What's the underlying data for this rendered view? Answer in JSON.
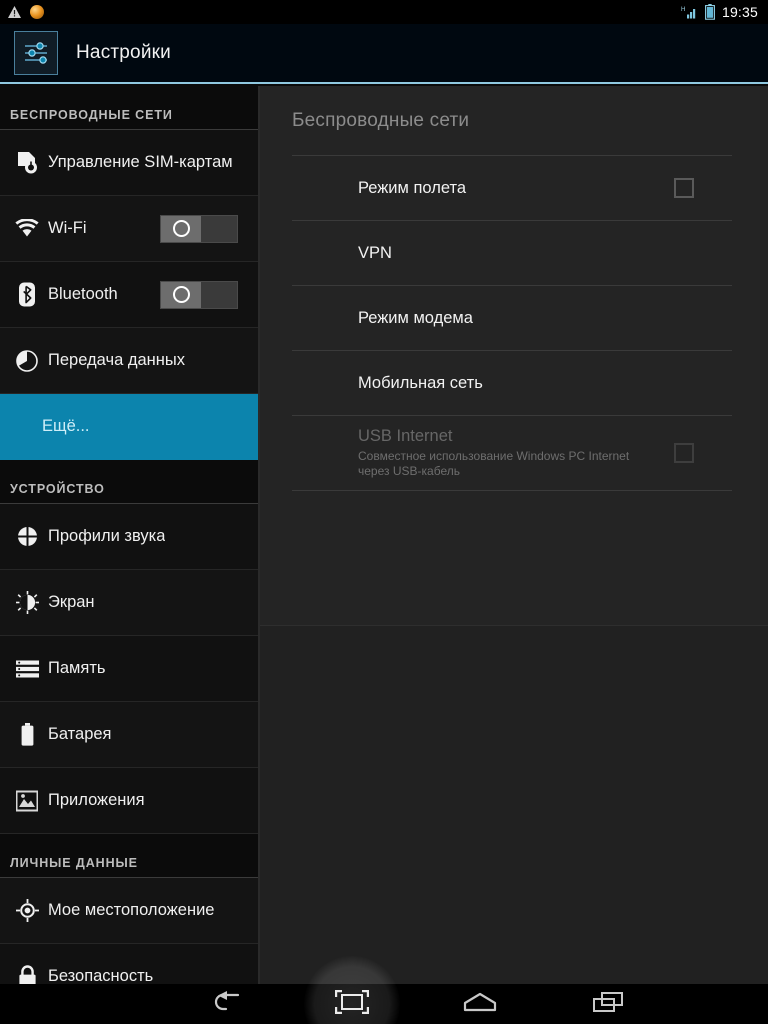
{
  "statusbar": {
    "time": "19:35",
    "notification_icons": [
      "warning-triangle-icon",
      "amber-circle-icon"
    ],
    "system_icons": [
      "signal-h-icon",
      "battery-icon"
    ],
    "signal_label": "H"
  },
  "actionbar": {
    "app_icon": "settings-sliders-icon",
    "title": "Настройки"
  },
  "sidebar": {
    "sections": [
      {
        "header": "БЕСПРОВОДНЫЕ СЕТИ",
        "items": [
          {
            "label": "Управление SIM-картам",
            "icon": "sim-card-icon",
            "control": "none",
            "selected": false
          },
          {
            "label": "Wi-Fi",
            "icon": "wifi-icon",
            "control": "toggle",
            "toggle_state": "off",
            "selected": false
          },
          {
            "label": "Bluetooth",
            "icon": "bluetooth-icon",
            "control": "toggle",
            "toggle_state": "off",
            "selected": false
          },
          {
            "label": "Передача данных",
            "icon": "data-usage-icon",
            "control": "none",
            "selected": false
          },
          {
            "label": "Ещё...",
            "icon": "none",
            "control": "none",
            "selected": true
          }
        ]
      },
      {
        "header": "УСТРОЙСТВО",
        "items": [
          {
            "label": "Профили звука",
            "icon": "sound-profile-icon",
            "control": "none",
            "selected": false
          },
          {
            "label": "Экран",
            "icon": "display-brightness-icon",
            "control": "none",
            "selected": false
          },
          {
            "label": "Память",
            "icon": "storage-icon",
            "control": "none",
            "selected": false
          },
          {
            "label": "Батарея",
            "icon": "battery-icon",
            "control": "none",
            "selected": false
          },
          {
            "label": "Приложения",
            "icon": "apps-icon",
            "control": "none",
            "selected": false
          }
        ]
      },
      {
        "header": "ЛИЧНЫЕ ДАННЫЕ",
        "items": [
          {
            "label": "Мое местоположение",
            "icon": "location-icon",
            "control": "none",
            "selected": false
          },
          {
            "label": "Безопасность",
            "icon": "lock-icon",
            "control": "none",
            "selected": false
          }
        ]
      }
    ]
  },
  "main": {
    "title": "Беспроводные сети",
    "rows": [
      {
        "title": "Режим полета",
        "subtitle": "",
        "control": "checkbox",
        "checked": false,
        "disabled": false
      },
      {
        "title": "VPN",
        "subtitle": "",
        "control": "none",
        "checked": false,
        "disabled": false
      },
      {
        "title": "Режим модема",
        "subtitle": "",
        "control": "none",
        "checked": false,
        "disabled": false
      },
      {
        "title": "Мобильная сеть",
        "subtitle": "",
        "control": "none",
        "checked": false,
        "disabled": false
      },
      {
        "title": "USB Internet",
        "subtitle": "Совместное использование Windows PC Internet через USB-кабель",
        "control": "checkbox",
        "checked": false,
        "disabled": true
      }
    ]
  },
  "navbar": {
    "buttons": [
      {
        "name": "back",
        "icon": "back-arrow-icon",
        "pressed": false
      },
      {
        "name": "screenshot",
        "icon": "screenshot-frame-icon",
        "pressed": true
      },
      {
        "name": "home",
        "icon": "home-icon",
        "pressed": false
      },
      {
        "name": "recents",
        "icon": "recents-icon",
        "pressed": false
      }
    ]
  },
  "colors": {
    "accent": "#0c84ad",
    "actionbar_underline": "#8fc8e0",
    "sidebar_bg": "#111111",
    "panel_bg": "#242424"
  }
}
